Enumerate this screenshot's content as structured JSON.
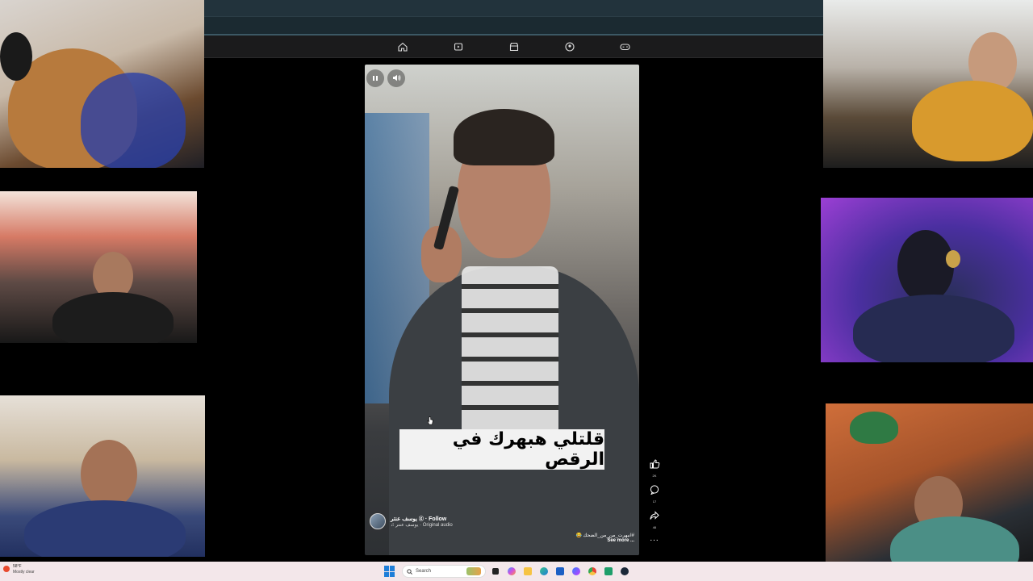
{
  "video": {
    "caption": "قلتلي هبهرك في الرقص",
    "author_name": "يوسف عنتر",
    "follow_label": "· Follow",
    "audio_label": "يوسف عنتر · Original audio",
    "hashtag": "#انبهرت_من_من_الضحك 😂",
    "see_more_label": "See more ..."
  },
  "actions": {
    "likes": "2K",
    "comments": "17",
    "shares": "46",
    "more": "..."
  },
  "taskbar": {
    "weather_temp": "58°F",
    "weather_condition": "Mostly clear",
    "search_placeholder": "Search"
  },
  "nav_icons": [
    "home-icon",
    "video-icon",
    "marketplace-icon",
    "groups-icon",
    "gaming-icon"
  ],
  "colors": {
    "taskbar_bg": "#f3e7ea",
    "browser_bar": "#22333c",
    "caption_bg": "#f2f2f2"
  }
}
